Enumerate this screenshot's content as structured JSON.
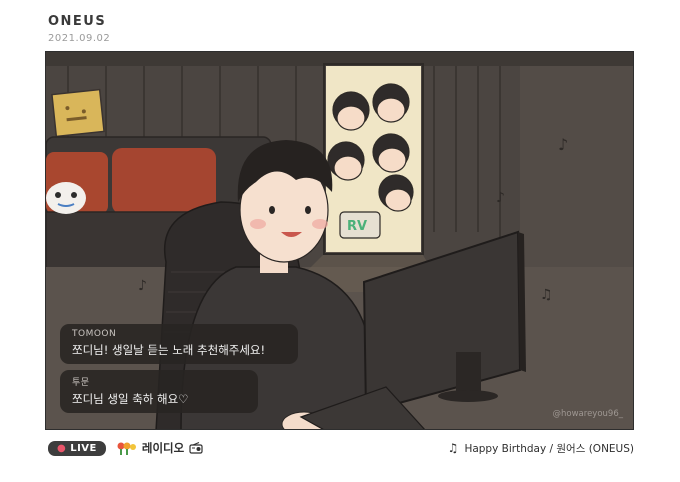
{
  "header": {
    "brand": "ONEUS",
    "date": "2021.09.02"
  },
  "chat": [
    {
      "user": "TOMOON",
      "message": "쪼디님! 생일날 듣는 노래 추천해주세요!"
    },
    {
      "user": "투문",
      "message": "쪼디님 생일 축하 해요♡"
    }
  ],
  "watermark": "@howareyou96_",
  "footer": {
    "live_label": "LIVE",
    "station": "레이디오",
    "song": "Happy Birthday / 원어스 (ONEUS)",
    "note_symbol": "♫"
  },
  "icons": [
    "flower-icon",
    "radio-icon",
    "music-note-icon"
  ]
}
